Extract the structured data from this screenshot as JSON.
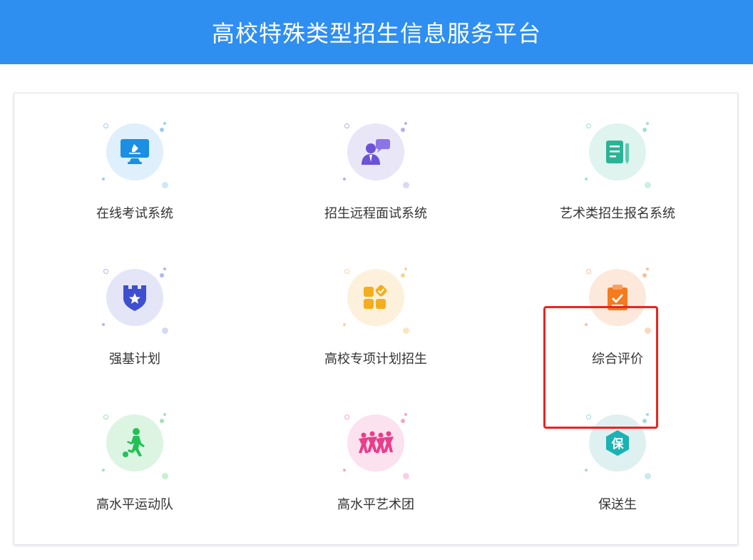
{
  "header": {
    "title": "高校特殊类型招生信息服务平台"
  },
  "colors": {
    "header_bg": "#2e8ff0",
    "highlight": "#e8251e"
  },
  "tiles": [
    {
      "label": "在线考试系统",
      "icon": "online-exam-icon",
      "bg": "#dff0fc",
      "fg": "#1a8fe3",
      "dot": "#9ccdf3"
    },
    {
      "label": "招生远程面试系统",
      "icon": "remote-interview-icon",
      "bg": "#e9e6f8",
      "fg": "#6b52d6",
      "dot": "#b9aeec"
    },
    {
      "label": "艺术类招生报名系统",
      "icon": "art-registration-icon",
      "bg": "#dff4ef",
      "fg": "#2bb396",
      "dot": "#a3dfcf"
    },
    {
      "label": "强基计划",
      "icon": "strong-foundation-icon",
      "bg": "#e4e6f8",
      "fg": "#3e4fcf",
      "dot": "#b1b7ec"
    },
    {
      "label": "高校专项计划招生",
      "icon": "special-plan-icon",
      "bg": "#fdf1dc",
      "fg": "#f3ad1e",
      "dot": "#f6d496"
    },
    {
      "label": "综合评价",
      "icon": "comprehensive-evaluation-icon",
      "bg": "#fde9dc",
      "fg": "#f47b1f",
      "dot": "#f8c09b"
    },
    {
      "label": "高水平运动队",
      "icon": "sports-team-icon",
      "bg": "#dcf5e3",
      "fg": "#23c155",
      "dot": "#a0e3b4"
    },
    {
      "label": "高水平艺术团",
      "icon": "art-troupe-icon",
      "bg": "#fce1ee",
      "fg": "#ea3d8c",
      "dot": "#f3a6cb"
    },
    {
      "label": "保送生",
      "icon": "recommended-student-icon",
      "bg": "#dff0f0",
      "fg": "#1bb2b4",
      "dot": "#a2dadb",
      "glyph": "保"
    }
  ]
}
